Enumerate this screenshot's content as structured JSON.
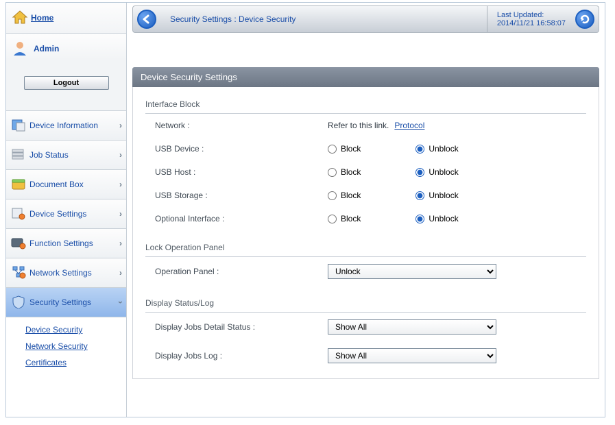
{
  "sidebar": {
    "home": "Home",
    "admin": "Admin",
    "logout": "Logout",
    "items": [
      {
        "label": "Device Information"
      },
      {
        "label": "Job Status"
      },
      {
        "label": "Document Box"
      },
      {
        "label": "Device Settings"
      },
      {
        "label": "Function Settings"
      },
      {
        "label": "Network Settings"
      },
      {
        "label": "Security Settings"
      }
    ],
    "subnav": [
      "Device Security",
      "Network Security",
      "Certificates"
    ]
  },
  "header": {
    "breadcrumb": "Security Settings : Device Security",
    "last_updated_label": "Last Updated:",
    "last_updated_time": "2014/11/21 16:58:07"
  },
  "section": {
    "title": "Device Security Settings",
    "interface_block": {
      "title": "Interface Block",
      "network_label": "Network :",
      "network_text": "Refer to this link.",
      "network_link": "Protocol",
      "rows": [
        {
          "label": "USB Device :",
          "block": "Block",
          "unblock": "Unblock",
          "value": "unblock"
        },
        {
          "label": "USB Host :",
          "block": "Block",
          "unblock": "Unblock",
          "value": "unblock"
        },
        {
          "label": "USB Storage :",
          "block": "Block",
          "unblock": "Unblock",
          "value": "unblock"
        },
        {
          "label": "Optional Interface :",
          "block": "Block",
          "unblock": "Unblock",
          "value": "unblock"
        }
      ]
    },
    "lock_panel": {
      "title": "Lock Operation Panel",
      "label": "Operation Panel :",
      "value": "Unlock"
    },
    "display_status": {
      "title": "Display Status/Log",
      "rows": [
        {
          "label": "Display Jobs Detail Status :",
          "value": "Show All"
        },
        {
          "label": "Display Jobs Log :",
          "value": "Show All"
        }
      ]
    }
  }
}
